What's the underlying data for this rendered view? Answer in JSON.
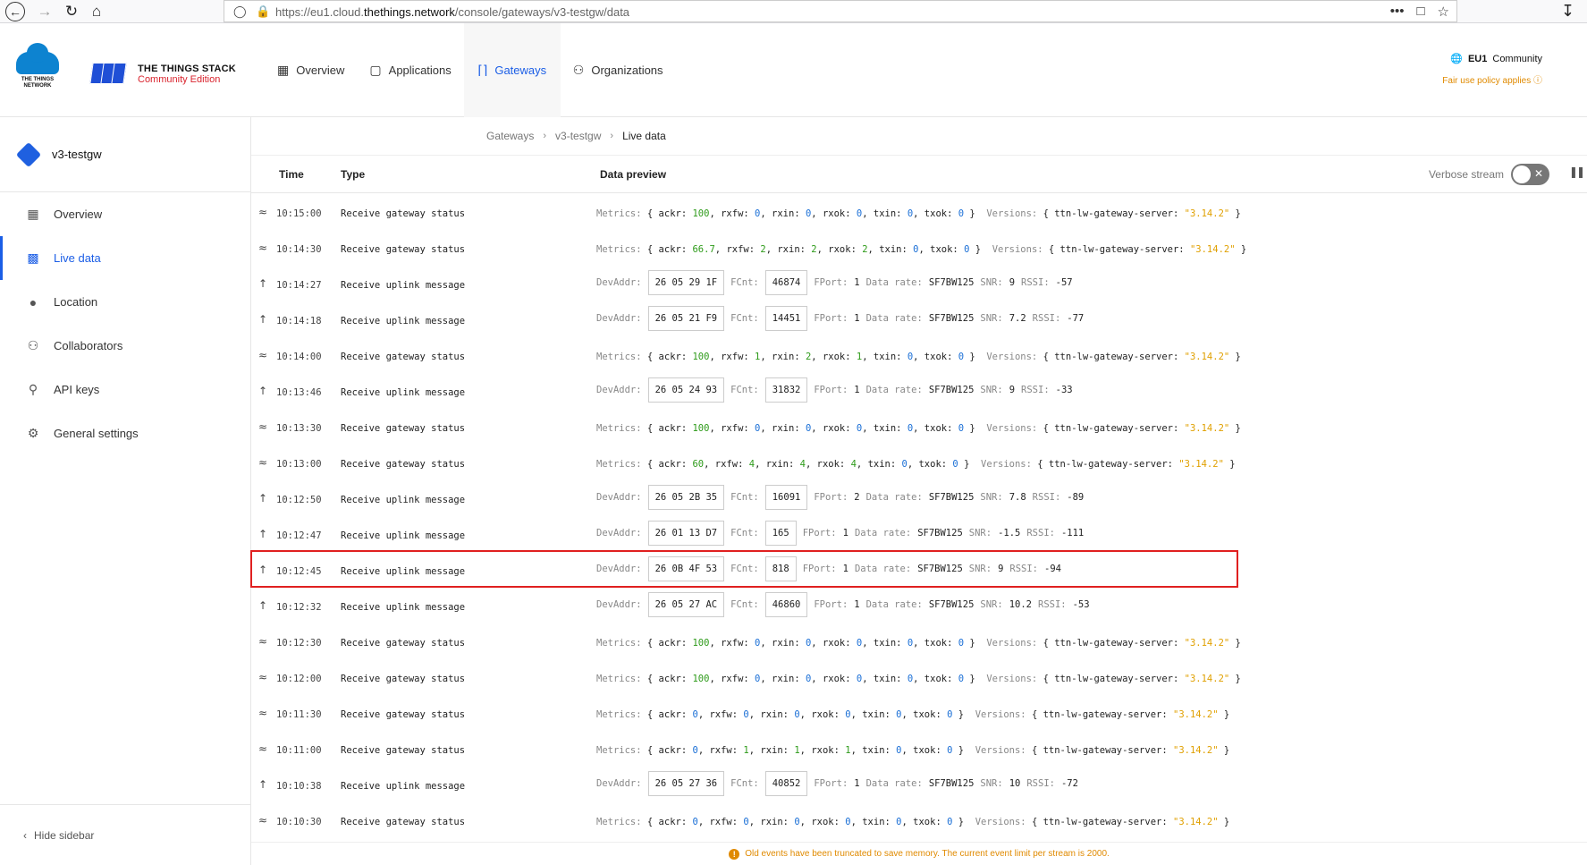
{
  "browser": {
    "url_prefix": "https://eu1.cloud.",
    "url_domain": "thethings.network",
    "url_path": "/console/gateways/v3-testgw/data"
  },
  "brand": {
    "ttn_logo_text_1": "THE THINGS",
    "ttn_logo_text_2": "NETWORK",
    "stack_title": "THE THINGS STACK",
    "stack_subtitle": "Community Edition"
  },
  "nav": {
    "tabs": [
      {
        "label": "Overview",
        "icon": "grid-icon"
      },
      {
        "label": "Applications",
        "icon": "applications-icon"
      },
      {
        "label": "Gateways",
        "icon": "gateway-icon",
        "active": true
      },
      {
        "label": "Organizations",
        "icon": "people-icon"
      }
    ]
  },
  "region": {
    "name": "EU1",
    "tier": "Community",
    "policy": "Fair use policy applies"
  },
  "sidebar": {
    "gateway_name": "v3-testgw",
    "items": [
      {
        "label": "Overview",
        "icon": "grid-icon"
      },
      {
        "label": "Live data",
        "icon": "chart-icon",
        "active": true
      },
      {
        "label": "Location",
        "icon": "location-pin-icon"
      },
      {
        "label": "Collaborators",
        "icon": "people-icon"
      },
      {
        "label": "API keys",
        "icon": "key-icon"
      },
      {
        "label": "General settings",
        "icon": "gear-icon"
      }
    ],
    "hide_label": "Hide sidebar"
  },
  "breadcrumb": [
    "Gateways",
    "v3-testgw",
    "Live data"
  ],
  "table": {
    "col_time": "Time",
    "col_type": "Type",
    "col_preview": "Data preview",
    "verbose_label": "Verbose stream",
    "verbose_on": false
  },
  "events": [
    {
      "kind": "status",
      "time": "10:15:00",
      "type": "Receive gateway status",
      "ackr": "100",
      "rxfw": "0",
      "rxin": "0",
      "rxok": "0",
      "txin": "0",
      "txok": "0",
      "version": "\"3.14.2\""
    },
    {
      "kind": "status",
      "time": "10:14:30",
      "type": "Receive gateway status",
      "ackr": "66.7",
      "rxfw": "2",
      "rxin": "2",
      "rxok": "2",
      "txin": "0",
      "txok": "0",
      "version": "\"3.14.2\""
    },
    {
      "kind": "uplink",
      "time": "10:14:27",
      "type": "Receive uplink message",
      "devaddr": "26 05 29 1F",
      "fcnt": "46874",
      "fport": "1",
      "datarate": "SF7BW125",
      "snr": "9",
      "rssi": "-57"
    },
    {
      "kind": "uplink",
      "time": "10:14:18",
      "type": "Receive uplink message",
      "devaddr": "26 05 21 F9",
      "fcnt": "14451",
      "fport": "1",
      "datarate": "SF7BW125",
      "snr": "7.2",
      "rssi": "-77"
    },
    {
      "kind": "status",
      "time": "10:14:00",
      "type": "Receive gateway status",
      "ackr": "100",
      "rxfw": "1",
      "rxin": "2",
      "rxok": "1",
      "txin": "0",
      "txok": "0",
      "version": "\"3.14.2\""
    },
    {
      "kind": "uplink",
      "time": "10:13:46",
      "type": "Receive uplink message",
      "devaddr": "26 05 24 93",
      "fcnt": "31832",
      "fport": "1",
      "datarate": "SF7BW125",
      "snr": "9",
      "rssi": "-33"
    },
    {
      "kind": "status",
      "time": "10:13:30",
      "type": "Receive gateway status",
      "ackr": "100",
      "rxfw": "0",
      "rxin": "0",
      "rxok": "0",
      "txin": "0",
      "txok": "0",
      "version": "\"3.14.2\""
    },
    {
      "kind": "status",
      "time": "10:13:00",
      "type": "Receive gateway status",
      "ackr": "60",
      "rxfw": "4",
      "rxin": "4",
      "rxok": "4",
      "txin": "0",
      "txok": "0",
      "version": "\"3.14.2\""
    },
    {
      "kind": "uplink",
      "time": "10:12:50",
      "type": "Receive uplink message",
      "devaddr": "26 05 2B 35",
      "fcnt": "16091",
      "fport": "2",
      "datarate": "SF7BW125",
      "snr": "7.8",
      "rssi": "-89"
    },
    {
      "kind": "uplink",
      "time": "10:12:47",
      "type": "Receive uplink message",
      "devaddr": "26 01 13 D7",
      "fcnt": "165",
      "fport": "1",
      "datarate": "SF7BW125",
      "snr": "-1.5",
      "rssi": "-111"
    },
    {
      "kind": "uplink",
      "time": "10:12:45",
      "type": "Receive uplink message",
      "devaddr": "26 0B 4F 53",
      "fcnt": "818",
      "fport": "1",
      "datarate": "SF7BW125",
      "snr": "9",
      "rssi": "-94"
    },
    {
      "kind": "uplink",
      "time": "10:12:32",
      "type": "Receive uplink message",
      "devaddr": "26 05 27 AC",
      "fcnt": "46860",
      "fport": "1",
      "datarate": "SF7BW125",
      "snr": "10.2",
      "rssi": "-53"
    },
    {
      "kind": "status",
      "time": "10:12:30",
      "type": "Receive gateway status",
      "ackr": "100",
      "rxfw": "0",
      "rxin": "0",
      "rxok": "0",
      "txin": "0",
      "txok": "0",
      "version": "\"3.14.2\""
    },
    {
      "kind": "status",
      "time": "10:12:00",
      "type": "Receive gateway status",
      "ackr": "100",
      "rxfw": "0",
      "rxin": "0",
      "rxok": "0",
      "txin": "0",
      "txok": "0",
      "version": "\"3.14.2\""
    },
    {
      "kind": "status",
      "time": "10:11:30",
      "type": "Receive gateway status",
      "ackr": "0",
      "rxfw": "0",
      "rxin": "0",
      "rxok": "0",
      "txin": "0",
      "txok": "0",
      "version": "\"3.14.2\""
    },
    {
      "kind": "status",
      "time": "10:11:00",
      "type": "Receive gateway status",
      "ackr": "0",
      "rxfw": "1",
      "rxin": "1",
      "rxok": "1",
      "txin": "0",
      "txok": "0",
      "version": "\"3.14.2\""
    },
    {
      "kind": "uplink",
      "time": "10:10:38",
      "type": "Receive uplink message",
      "devaddr": "26 05 27 36",
      "fcnt": "40852",
      "fport": "1",
      "datarate": "SF7BW125",
      "snr": "10",
      "rssi": "-72"
    },
    {
      "kind": "status",
      "time": "10:10:30",
      "type": "Receive gateway status",
      "ackr": "0",
      "rxfw": "0",
      "rxin": "0",
      "rxok": "0",
      "txin": "0",
      "txok": "0",
      "version": "\"3.14.2\""
    }
  ],
  "labels": {
    "metrics": "Metrics:",
    "versions": "Versions:",
    "server_key": "ttn-lw-gateway-server:",
    "devaddr": "DevAddr:",
    "fcnt": "FCnt:",
    "fport": "FPort:",
    "datarate": "Data rate:",
    "snr": "SNR:",
    "rssi": "RSSI:"
  },
  "footer": {
    "truncated_msg": "Old events have been truncated to save memory. The current event limit per stream is 2000."
  },
  "colors": {
    "accent": "#1b5ee6",
    "highlight_border": "#e02020",
    "warning": "#e08a00"
  }
}
